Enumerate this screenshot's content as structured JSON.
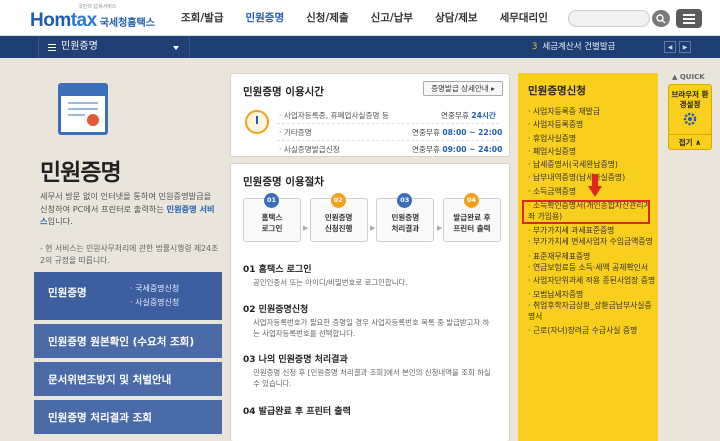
{
  "header": {
    "logo_tagline": "국민의 납세서비스",
    "logo_home": "Hom",
    "logo_tax": "tax",
    "logo_sub": "국세청홈택스",
    "menu": [
      "조회/발급",
      "민원증명",
      "신청/제출",
      "신고/납부",
      "상담/제보",
      "세무대리인"
    ],
    "active_menu": "민원증명",
    "search_placeholder": ""
  },
  "subbar": {
    "current": "민원증명",
    "notice_num": "3",
    "notice_text": "세금계산서 건별발급"
  },
  "left": {
    "title": "민원증명",
    "intro_1": "세무서 방문 없이 인터넷을 통하여 민원증명발급을 신청하여 PC에서 프린터로 출력하는 ",
    "intro_hl": "민원증명 서비스",
    "intro_2": "입니다.",
    "law": "- 현 서비스는 민원사무처리에 관한 법률시행령 제24조2의 규정을 따릅니다.",
    "nav": [
      {
        "label": "민원증명",
        "subs": [
          "국세증명신청",
          "사실증명신청"
        ]
      },
      {
        "label": "민원증명 원본확인 (수요처 조회)"
      },
      {
        "label": "문서위변조방지 및 처벌안내"
      },
      {
        "label": "민원증명 처리결과 조회"
      }
    ]
  },
  "time_card": {
    "title": "민원증명 이용시간",
    "detail_btn": "증명발급 상세안내",
    "rows": [
      {
        "label": "사업자등록증, 휴폐업사실증명 등",
        "value_prefix": "연중무휴 ",
        "value_hl": "24시간"
      },
      {
        "label": "기타증명",
        "value_prefix": "연중무휴 ",
        "value_hl": "08:00 ~ 22:00"
      },
      {
        "label": "사실증명발급신청",
        "value_prefix": "연중무휴 ",
        "value_hl": "09:00 ~ 24:00"
      }
    ]
  },
  "procedure": {
    "title": "민원증명 이용절차",
    "steps": [
      {
        "num": "01",
        "label_1": "홈택스",
        "label_2": "로그인",
        "color": "#3b6fb9"
      },
      {
        "num": "02",
        "label_1": "민원증명",
        "label_2": "신청진행",
        "color": "#f0a21d"
      },
      {
        "num": "03",
        "label_1": "민원증명",
        "label_2": "처리결과",
        "color": "#3b6fb9"
      },
      {
        "num": "04",
        "label_1": "발급완료 후",
        "label_2": "프린터 출력",
        "color": "#f0a21d"
      }
    ],
    "sections": [
      {
        "heading": "01 홈택스 로그인",
        "text": "공인인증서 또는 아이디/비밀번호로 로그인합니다."
      },
      {
        "heading": "02 민원증명신청",
        "text": "사업자등록번호가 필요한 증명일 경우 사업자등록번호 목록 중 발급받고자 하는 사업자등록번호를 선택합니다."
      },
      {
        "heading": "03 나의 민원증명 처리결과",
        "text": "민원증명 신청 후 [민원증명 처리결과 조회]에서 본인의 신청내역을 조회 하실 수 있습니다."
      },
      {
        "heading": "04 발급완료 후 프린터 출력",
        "text": ""
      }
    ]
  },
  "apply_list": {
    "title": "민원증명신청",
    "items": [
      "사업자등록증 재발급",
      "사업자등록증명",
      "휴업사실증명",
      "폐업사실증명",
      "납세증명서(국세완납증명)",
      "납부내역증명(납세사실증명)",
      "소득금액증명",
      "소득확인증명서(개인종합자산관리계좌 가입용)",
      "부가가치세 과세표준증명",
      "부가가치세 면세사업자 수입금액증명",
      "표준재무제표증명",
      "연금보험료등 소득·세액 공제확인서",
      "사업자단위과세 적용 종된사업장 증명",
      "모범납세자증명",
      "취업후학자금상환_상환금납부사실증명서",
      "근로(자녀)장려금 수급사실 증명"
    ],
    "highlighted": "소득확인증명서(개인종합자산관리계좌 가입용)"
  },
  "quick": {
    "label": "QUICK",
    "box_text": "브라우저 환경설정",
    "close": "접기"
  },
  "colors": {
    "primary": "#1f5fb3",
    "navy": "#1d3e73",
    "yellow": "#f7cf1c",
    "highlight": "#e0261f"
  }
}
